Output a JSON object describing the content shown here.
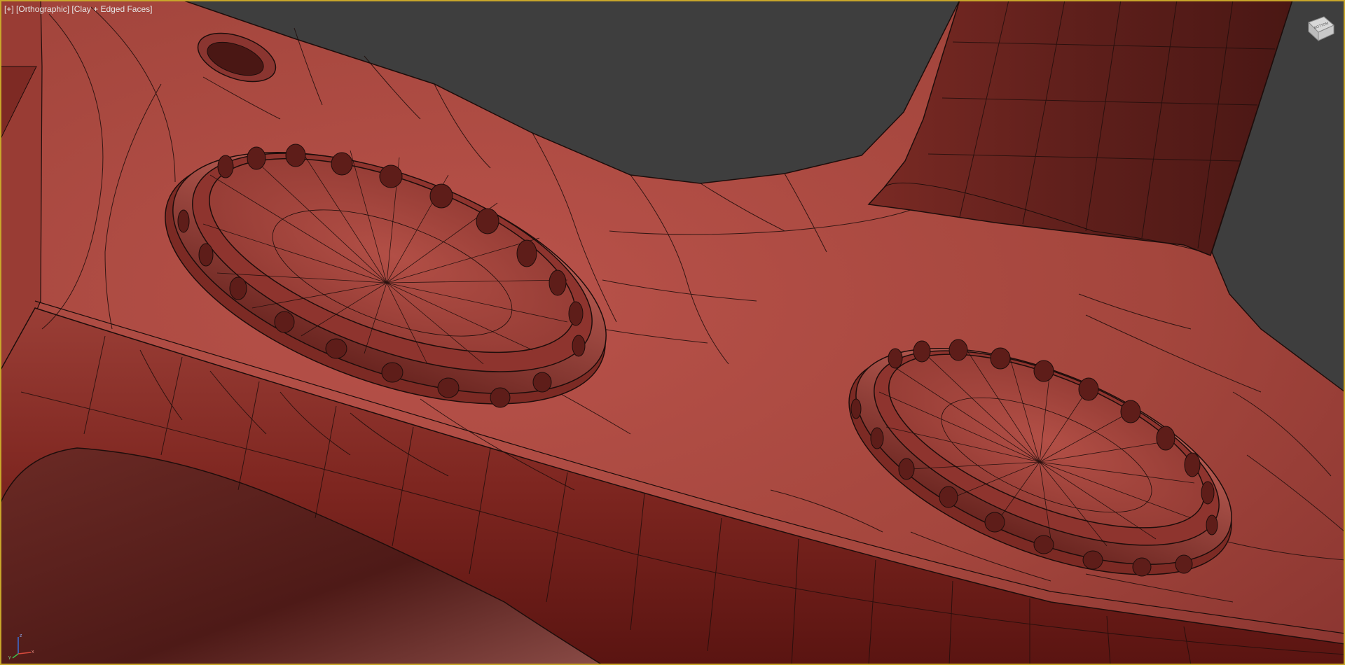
{
  "viewport": {
    "label_plus": "[+]",
    "label_view": "[Orthographic]",
    "label_shading": "[Clay + Edged Faces]"
  },
  "viewcube": {
    "face_label": "BOTTOM",
    "icon": "viewcube-icon"
  },
  "axis_tripod": {
    "x_label": "x",
    "y_label": "y",
    "z_label": "z",
    "icon": "axis-tripod-icon"
  },
  "colors": {
    "background": "#3e3e3e",
    "clay": "#a7453a",
    "clay_dark": "#6e1e1a",
    "wire": "#1e0d0b",
    "border_active": "#c8a62a"
  }
}
